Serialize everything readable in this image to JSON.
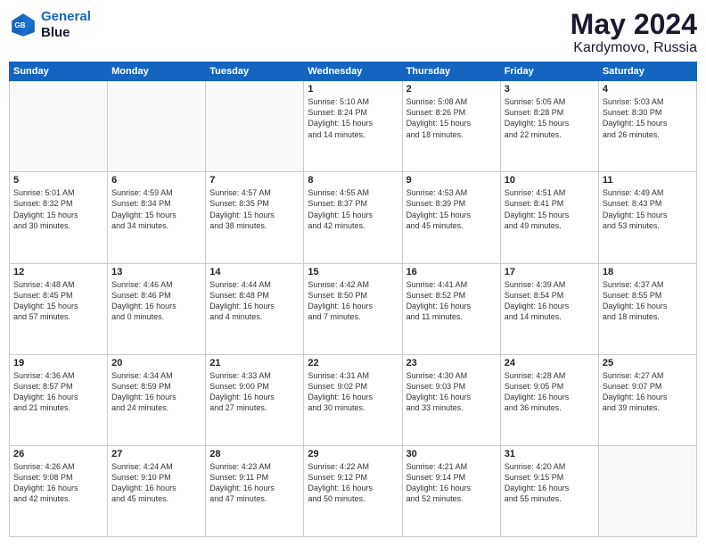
{
  "logo": {
    "line1": "General",
    "line2": "Blue"
  },
  "title": "May 2024",
  "location": "Kardymovo, Russia",
  "days_header": [
    "Sunday",
    "Monday",
    "Tuesday",
    "Wednesday",
    "Thursday",
    "Friday",
    "Saturday"
  ],
  "weeks": [
    [
      {
        "day": "",
        "text": ""
      },
      {
        "day": "",
        "text": ""
      },
      {
        "day": "",
        "text": ""
      },
      {
        "day": "1",
        "text": "Sunrise: 5:10 AM\nSunset: 8:24 PM\nDaylight: 15 hours\nand 14 minutes."
      },
      {
        "day": "2",
        "text": "Sunrise: 5:08 AM\nSunset: 8:26 PM\nDaylight: 15 hours\nand 18 minutes."
      },
      {
        "day": "3",
        "text": "Sunrise: 5:05 AM\nSunset: 8:28 PM\nDaylight: 15 hours\nand 22 minutes."
      },
      {
        "day": "4",
        "text": "Sunrise: 5:03 AM\nSunset: 8:30 PM\nDaylight: 15 hours\nand 26 minutes."
      }
    ],
    [
      {
        "day": "5",
        "text": "Sunrise: 5:01 AM\nSunset: 8:32 PM\nDaylight: 15 hours\nand 30 minutes."
      },
      {
        "day": "6",
        "text": "Sunrise: 4:59 AM\nSunset: 8:34 PM\nDaylight: 15 hours\nand 34 minutes."
      },
      {
        "day": "7",
        "text": "Sunrise: 4:57 AM\nSunset: 8:35 PM\nDaylight: 15 hours\nand 38 minutes."
      },
      {
        "day": "8",
        "text": "Sunrise: 4:55 AM\nSunset: 8:37 PM\nDaylight: 15 hours\nand 42 minutes."
      },
      {
        "day": "9",
        "text": "Sunrise: 4:53 AM\nSunset: 8:39 PM\nDaylight: 15 hours\nand 45 minutes."
      },
      {
        "day": "10",
        "text": "Sunrise: 4:51 AM\nSunset: 8:41 PM\nDaylight: 15 hours\nand 49 minutes."
      },
      {
        "day": "11",
        "text": "Sunrise: 4:49 AM\nSunset: 8:43 PM\nDaylight: 15 hours\nand 53 minutes."
      }
    ],
    [
      {
        "day": "12",
        "text": "Sunrise: 4:48 AM\nSunset: 8:45 PM\nDaylight: 15 hours\nand 57 minutes."
      },
      {
        "day": "13",
        "text": "Sunrise: 4:46 AM\nSunset: 8:46 PM\nDaylight: 16 hours\nand 0 minutes."
      },
      {
        "day": "14",
        "text": "Sunrise: 4:44 AM\nSunset: 8:48 PM\nDaylight: 16 hours\nand 4 minutes."
      },
      {
        "day": "15",
        "text": "Sunrise: 4:42 AM\nSunset: 8:50 PM\nDaylight: 16 hours\nand 7 minutes."
      },
      {
        "day": "16",
        "text": "Sunrise: 4:41 AM\nSunset: 8:52 PM\nDaylight: 16 hours\nand 11 minutes."
      },
      {
        "day": "17",
        "text": "Sunrise: 4:39 AM\nSunset: 8:54 PM\nDaylight: 16 hours\nand 14 minutes."
      },
      {
        "day": "18",
        "text": "Sunrise: 4:37 AM\nSunset: 8:55 PM\nDaylight: 16 hours\nand 18 minutes."
      }
    ],
    [
      {
        "day": "19",
        "text": "Sunrise: 4:36 AM\nSunset: 8:57 PM\nDaylight: 16 hours\nand 21 minutes."
      },
      {
        "day": "20",
        "text": "Sunrise: 4:34 AM\nSunset: 8:59 PM\nDaylight: 16 hours\nand 24 minutes."
      },
      {
        "day": "21",
        "text": "Sunrise: 4:33 AM\nSunset: 9:00 PM\nDaylight: 16 hours\nand 27 minutes."
      },
      {
        "day": "22",
        "text": "Sunrise: 4:31 AM\nSunset: 9:02 PM\nDaylight: 16 hours\nand 30 minutes."
      },
      {
        "day": "23",
        "text": "Sunrise: 4:30 AM\nSunset: 9:03 PM\nDaylight: 16 hours\nand 33 minutes."
      },
      {
        "day": "24",
        "text": "Sunrise: 4:28 AM\nSunset: 9:05 PM\nDaylight: 16 hours\nand 36 minutes."
      },
      {
        "day": "25",
        "text": "Sunrise: 4:27 AM\nSunset: 9:07 PM\nDaylight: 16 hours\nand 39 minutes."
      }
    ],
    [
      {
        "day": "26",
        "text": "Sunrise: 4:26 AM\nSunset: 9:08 PM\nDaylight: 16 hours\nand 42 minutes."
      },
      {
        "day": "27",
        "text": "Sunrise: 4:24 AM\nSunset: 9:10 PM\nDaylight: 16 hours\nand 45 minutes."
      },
      {
        "day": "28",
        "text": "Sunrise: 4:23 AM\nSunset: 9:11 PM\nDaylight: 16 hours\nand 47 minutes."
      },
      {
        "day": "29",
        "text": "Sunrise: 4:22 AM\nSunset: 9:12 PM\nDaylight: 16 hours\nand 50 minutes."
      },
      {
        "day": "30",
        "text": "Sunrise: 4:21 AM\nSunset: 9:14 PM\nDaylight: 16 hours\nand 52 minutes."
      },
      {
        "day": "31",
        "text": "Sunrise: 4:20 AM\nSunset: 9:15 PM\nDaylight: 16 hours\nand 55 minutes."
      },
      {
        "day": "",
        "text": ""
      }
    ]
  ]
}
